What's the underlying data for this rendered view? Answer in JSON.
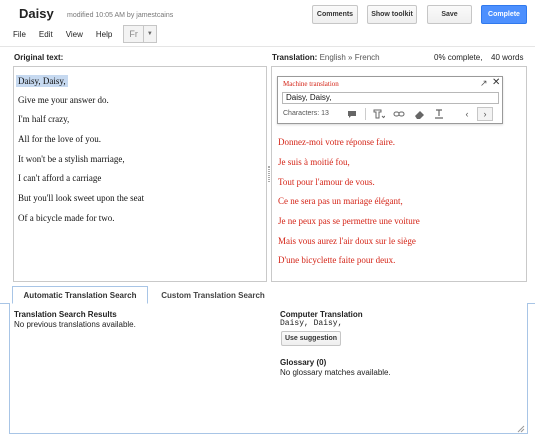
{
  "header": {
    "doc_title": "Daisy",
    "doc_meta": "modified 10:05 AM by jamestcains",
    "buttons": {
      "comments": "Comments",
      "show_toolkit": "Show toolkit",
      "save": "Save",
      "complete": "Complete"
    },
    "menu": [
      "File",
      "Edit",
      "View",
      "Help"
    ],
    "language_selector": "Fr"
  },
  "labels": {
    "original": "Original text:",
    "translation": "Translation:",
    "languages": "English » French",
    "progress": "0% complete,",
    "words": "40 words"
  },
  "original_lines": [
    "Daisy, Daisy,",
    "Give me your answer do.",
    "I'm half crazy,",
    "All for the love of you.",
    "It won't be a stylish marriage,",
    "I can't afford a carriage",
    "But you'll look sweet upon the seat",
    "Of a bicycle made for two."
  ],
  "machine_translation": {
    "title": "Machine translation",
    "input_value": "Daisy, Daisy,",
    "characters": "Characters: 13",
    "icons": [
      "comment-icon",
      "text-format-icon",
      "link-icon",
      "eraser-icon",
      "text-underline-icon"
    ]
  },
  "translated_lines": [
    "Donnez-moi votre réponse faire.",
    "Je suis à moitié fou,",
    "Tout pour l'amour de vous.",
    "Ce ne sera pas un mariage élégant,",
    "Je ne peux pas se permettre une voiture",
    "Mais vous aurez l'air doux sur le siège",
    "D'une bicyclette faite pour deux."
  ],
  "tabs": [
    "Automatic Translation Search",
    "Custom Translation Search"
  ],
  "search_results": {
    "heading": "Translation Search Results",
    "message": "No previous translations available."
  },
  "computer_translation": {
    "heading": "Computer Translation",
    "value": "Daisy, Daisy,",
    "button": "Use suggestion"
  },
  "glossary": {
    "heading": "Glossary (0)",
    "message": "No glossary matches available."
  },
  "colors": {
    "accent": "#4d90fe",
    "translation_text": "#d42417",
    "selection": "#c6d9f0"
  }
}
